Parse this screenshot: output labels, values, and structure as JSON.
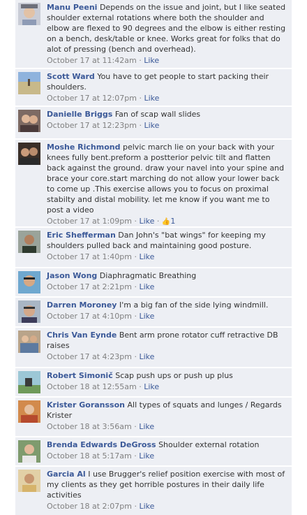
{
  "colors": {
    "background": "#edeff4",
    "separator": "#ffffff",
    "link": "#3b5998",
    "meta": "#808080",
    "text": "#333333"
  },
  "like_label": "Like",
  "comments": [
    {
      "author": "Manu Peeni",
      "text": "Depends on the issue and joint, but I like seated shoulder external rotations where both the shoulder and elbow are flexed to 90 degrees and the elbow is either resting on a bench, desk/table or knee. Works great for folks that do alot of pressing (bench and overhead).",
      "time": "October 17 at 11:42am"
    },
    {
      "author": "Scott Ward",
      "text": "You have to get people to start packing their shoulders.",
      "time": "October 17 at 12:07pm"
    },
    {
      "author": "Danielle Briggs",
      "text": "Fan of scap wall slides",
      "time": "October 17 at 12:23pm"
    },
    {
      "author": "Moshe Richmond",
      "text": "pelvic march lie on your back with your knees fully bent.preform a postterior pelvic tilt and flatten back against the ground. draw your navel into your spine and brace your core.start marching do not allow your lower back to come up .This exercise allows you to focus on proximal stabilty and distal mobility. let me know if you want me to post a video",
      "time": "October 17 at 1:09pm",
      "likes": "1",
      "thumb_icon": "thumbs-up-icon"
    },
    {
      "author": "Eric Shefferman",
      "text": "Dan John's \"bat wings\" for keeping my shoulders pulled back and maintaining good posture.",
      "time": "October 17 at 1:40pm"
    },
    {
      "author": "Jason Wong",
      "text": "Diaphragmatic Breathing",
      "time": "October 17 at 2:21pm"
    },
    {
      "author": "Darren Moroney",
      "text": "I'm a big fan of the side lying windmill.",
      "time": "October 17 at 4:10pm"
    },
    {
      "author": "Chris Van Eynde",
      "text": "Bent arm prone rotator cuff retractive DB raises",
      "time": "October 17 at 4:23pm"
    },
    {
      "author": "Robert Simonič",
      "text": "Scap push ups or push up plus",
      "time": "October 18 at 12:55am"
    },
    {
      "author": "Krister Goransson",
      "text": "All types of squats and lunges / Regards Krister",
      "time": "October 18 at 3:56am"
    },
    {
      "author": "Brenda Edwards DeGross",
      "text": "Shoulder external rotation",
      "time": "October 18 at 5:17am"
    },
    {
      "author": "Garcia Al",
      "text": "I use Brugger's relief position exercise with most of my clients as they get horrible postures in their daily life activities",
      "time": "October 18 at 2:07pm"
    }
  ]
}
